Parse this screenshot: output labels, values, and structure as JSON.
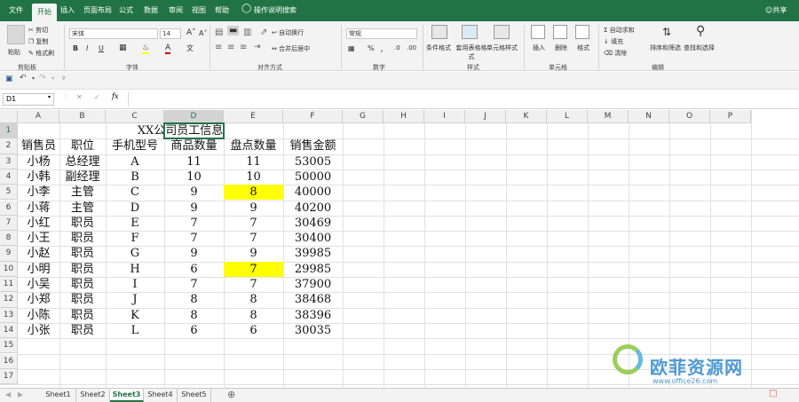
{
  "ribbon_tabs": [
    "文件",
    "开始",
    "插入",
    "页面布局",
    "公式",
    "数据",
    "审阅",
    "视图",
    "帮助"
  ],
  "active_tab": "开始",
  "tell_me": "操作说明搜索",
  "share": "共享",
  "clipboard": {
    "paste": "粘贴",
    "cut": "剪切",
    "copy": "复制",
    "format_painter": "格式刷",
    "group": "剪贴板"
  },
  "font": {
    "name": "宋体",
    "size": "14",
    "bold": "B",
    "italic": "I",
    "underline": "U",
    "group": "字体"
  },
  "alignment": {
    "wrap": "自动换行",
    "merge": "合并后居中",
    "group": "对齐方式"
  },
  "number": {
    "format": "常规",
    "percent": "%",
    "comma": "，",
    "group": "数字"
  },
  "styles": {
    "conditional": "条件格式",
    "table": "套用表格格式",
    "cell": "单元格样式",
    "group": "样式"
  },
  "cells": {
    "insert": "插入",
    "delete": "删除",
    "format": "格式",
    "group": "单元格"
  },
  "editing": {
    "autosum": "自动求和",
    "fill": "填充",
    "clear": "清除",
    "sort": "排序和筛选",
    "find": "查找和选择",
    "group": "编辑"
  },
  "formula_bar": {
    "name_box": "D1",
    "fx": "fx",
    "cancel": "✕",
    "enter": "✓",
    "content": ""
  },
  "columns": [
    "A",
    "B",
    "C",
    "D",
    "E",
    "F",
    "G",
    "H",
    "I",
    "J",
    "K",
    "L",
    "M",
    "N",
    "O",
    "P"
  ],
  "rows": [
    "1",
    "2",
    "3",
    "4",
    "5",
    "6",
    "7",
    "8",
    "9",
    "10",
    "11",
    "12",
    "13",
    "14",
    "15",
    "16",
    "17"
  ],
  "title": "XX公司员工信息",
  "headers": [
    "销售员",
    "职位",
    "手机型号",
    "商品数量",
    "盘点数量",
    "销售金额"
  ],
  "data": [
    [
      "小杨",
      "总经理",
      "A",
      "11",
      "11",
      "53005"
    ],
    [
      "小韩",
      "副经理",
      "B",
      "10",
      "10",
      "50000"
    ],
    [
      "小李",
      "主管",
      "C",
      "9",
      "8",
      "40000"
    ],
    [
      "小蒋",
      "主管",
      "D",
      "9",
      "9",
      "40200"
    ],
    [
      "小红",
      "职员",
      "E",
      "7",
      "7",
      "30469"
    ],
    [
      "小王",
      "职员",
      "F",
      "7",
      "7",
      "30400"
    ],
    [
      "小赵",
      "职员",
      "G",
      "9",
      "9",
      "39985"
    ],
    [
      "小明",
      "职员",
      "H",
      "6",
      "7",
      "29985"
    ],
    [
      "小吴",
      "职员",
      "I",
      "7",
      "7",
      "37900"
    ],
    [
      "小郑",
      "职员",
      "J",
      "8",
      "8",
      "38468"
    ],
    [
      "小陈",
      "职员",
      "K",
      "8",
      "8",
      "38396"
    ],
    [
      "小张",
      "职员",
      "L",
      "6",
      "6",
      "30035"
    ]
  ],
  "highlight_color": "#ffff00",
  "sheets": [
    "Sheet1",
    "Sheet2",
    "Sheet3",
    "Sheet4",
    "Sheet5"
  ],
  "active_sheet": "Sheet3",
  "watermark": {
    "brand": "欧菲资源网",
    "url": "www.office26.com"
  },
  "accent_color": "#217346"
}
